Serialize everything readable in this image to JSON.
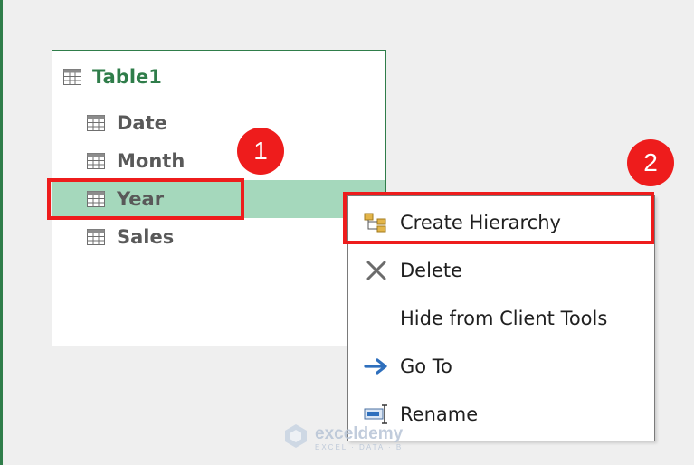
{
  "table": {
    "title": "Table1",
    "icon": "table-icon",
    "fields": [
      {
        "label": "Date",
        "icon": "table-icon",
        "selected": false
      },
      {
        "label": "Month",
        "icon": "table-icon",
        "selected": false
      },
      {
        "label": "Year",
        "icon": "table-icon",
        "selected": true
      },
      {
        "label": "Sales",
        "icon": "table-icon",
        "selected": false
      }
    ]
  },
  "context_menu": {
    "items": [
      {
        "label": "Create Hierarchy",
        "icon": "hierarchy-icon"
      },
      {
        "label": "Delete",
        "icon": "delete-x-icon"
      },
      {
        "label": "Hide from Client Tools",
        "icon": ""
      },
      {
        "label": "Go To",
        "icon": "arrow-right-icon"
      },
      {
        "label": "Rename",
        "icon": "rename-icon"
      }
    ]
  },
  "annotations": {
    "step1": "1",
    "step2": "2",
    "highlight_color": "#ee1c1c"
  },
  "colors": {
    "accent_green": "#2f7d4a",
    "selection": "#a5d8bc"
  },
  "watermark": {
    "name": "exceldemy",
    "tagline": "EXCEL · DATA · BI"
  }
}
